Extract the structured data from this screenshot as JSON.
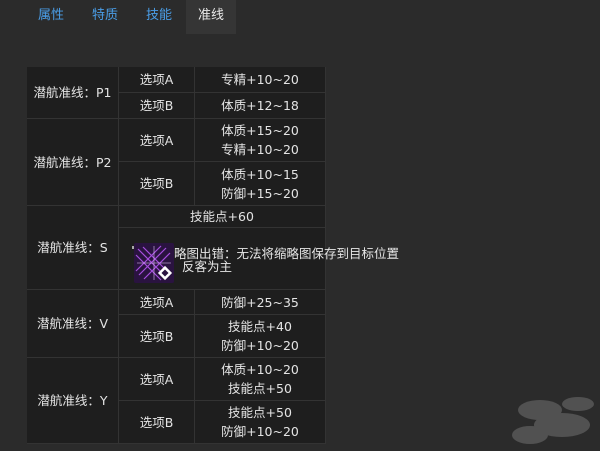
{
  "tabs": [
    {
      "label": "属性"
    },
    {
      "label": "特质"
    },
    {
      "label": "技能"
    },
    {
      "label": "准线"
    }
  ],
  "table": {
    "groups": [
      {
        "name": "潜航准线：P1",
        "options": [
          {
            "label": "选项A",
            "lines": [
              "专精+10~20"
            ]
          },
          {
            "label": "选项B",
            "lines": [
              "体质+12~18"
            ]
          }
        ]
      },
      {
        "name": "潜航准线：P2",
        "options": [
          {
            "label": "选项A",
            "lines": [
              "体质+15~20",
              "专精+10~20"
            ]
          },
          {
            "label": "选项B",
            "lines": [
              "体质+10~15",
              "防御+15~20"
            ]
          }
        ]
      },
      {
        "name": "潜航准线：S",
        "rows": [
          {
            "value": "技能点+60"
          }
        ]
      },
      {
        "name": "潜航准线：V",
        "options": [
          {
            "label": "选项A",
            "lines": [
              "防御+25~35"
            ]
          },
          {
            "label": "选项B",
            "lines": [
              "技能点+40",
              "防御+10~20"
            ]
          }
        ]
      },
      {
        "name": "潜航准线：Y",
        "options": [
          {
            "label": "选项A",
            "lines": [
              "体质+10~20",
              "技能点+50"
            ]
          },
          {
            "label": "选项B",
            "lines": [
              "技能点+50",
              "防御+10~20"
            ]
          }
        ]
      }
    ]
  },
  "overlay": {
    "error_text": "略图出错：无法将缩略图保存到目标位置",
    "item_name": "反客为主"
  }
}
